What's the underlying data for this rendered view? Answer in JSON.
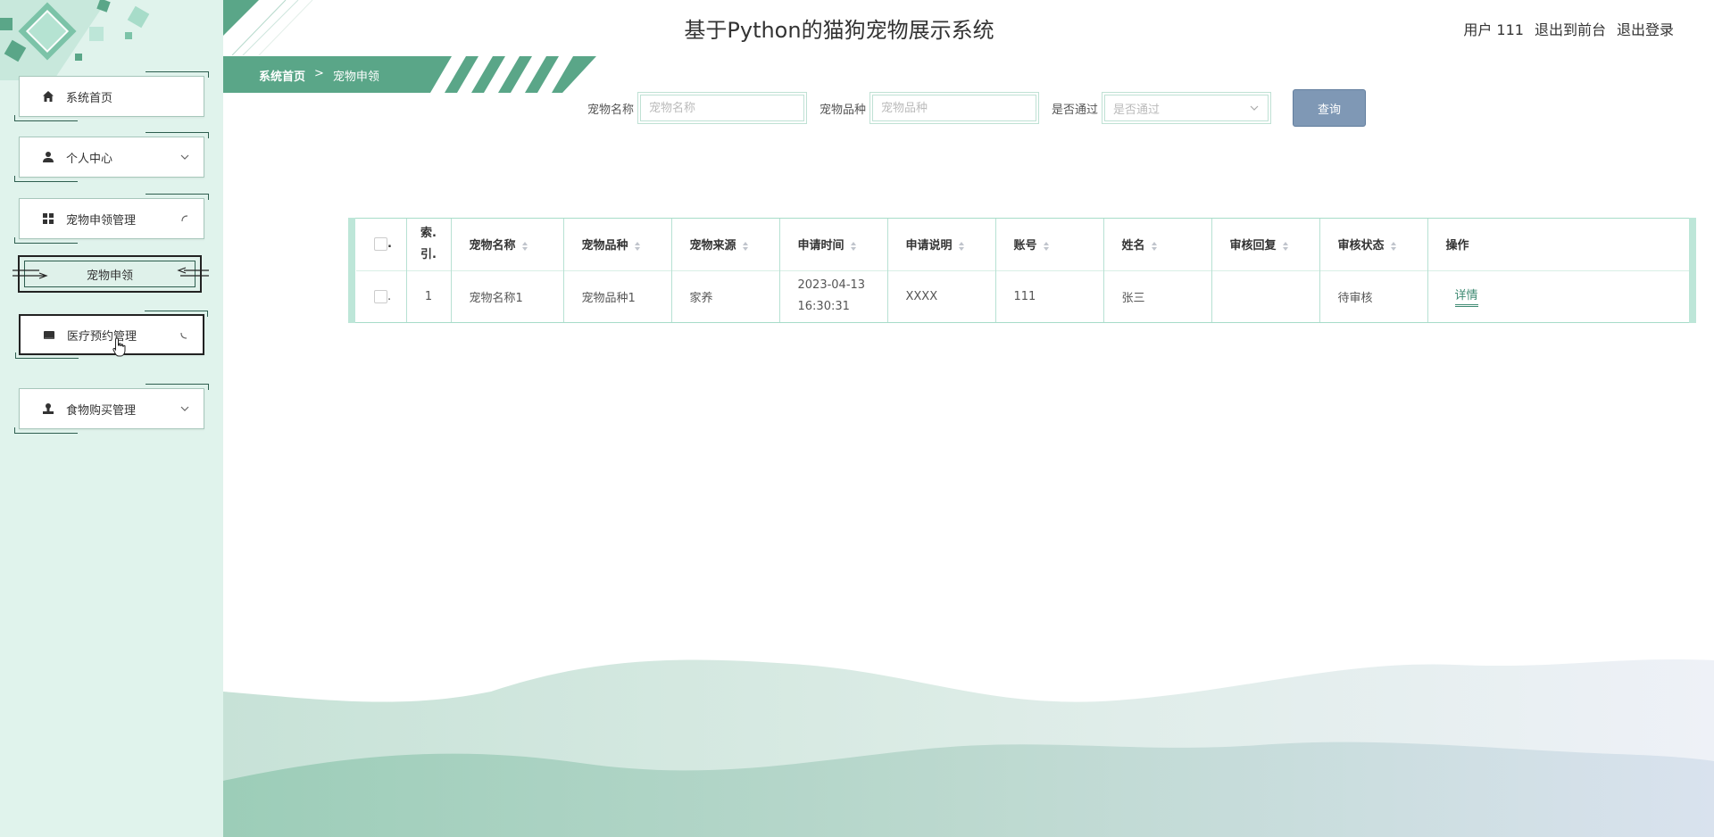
{
  "app": {
    "title": "基于Python的猫狗宠物展示系统"
  },
  "user": {
    "label": "用户 111",
    "to_front": "退出到前台",
    "logout": "退出登录"
  },
  "breadcrumb": {
    "home": "系统首页",
    "separator": ">",
    "current": "宠物申领"
  },
  "sidebar": {
    "items": [
      {
        "label": "系统首页",
        "icon": "home-icon"
      },
      {
        "label": "个人中心",
        "icon": "person-icon"
      },
      {
        "label": "宠物申领管理",
        "icon": "grid-icon"
      },
      {
        "label": "宠物申领",
        "icon": ""
      },
      {
        "label": "医疗预约管理",
        "icon": "calendar-icon"
      },
      {
        "label": "食物购买管理",
        "icon": "stamp-icon"
      }
    ]
  },
  "search": {
    "pet_name_label": "宠物名称",
    "pet_name_placeholder": "宠物名称",
    "pet_breed_label": "宠物品种",
    "pet_breed_placeholder": "宠物品种",
    "approved_label": "是否通过",
    "approved_placeholder": "是否通过",
    "button": "查询"
  },
  "table": {
    "columns": [
      "索.\n引.",
      "宠物名称",
      "宠物品种",
      "宠物来源",
      "申请时间",
      "申请说明",
      "账号",
      "姓名",
      "审核回复",
      "审核状态",
      "操作"
    ],
    "rows": [
      {
        "index": "1",
        "pet_name": "宠物名称1",
        "pet_breed": "宠物品种1",
        "pet_source": "家养",
        "apply_time": "2023-04-13\n16:30:31",
        "apply_desc": "XXXX",
        "account": "111",
        "name": "张三",
        "reply": "",
        "status": "待审核",
        "action": "详情"
      }
    ]
  },
  "colors": {
    "sidebar_bg": "#e0f3ec",
    "accent_green": "#5aa688",
    "search_button": "#7f98b5",
    "link": "#3e8a72"
  }
}
